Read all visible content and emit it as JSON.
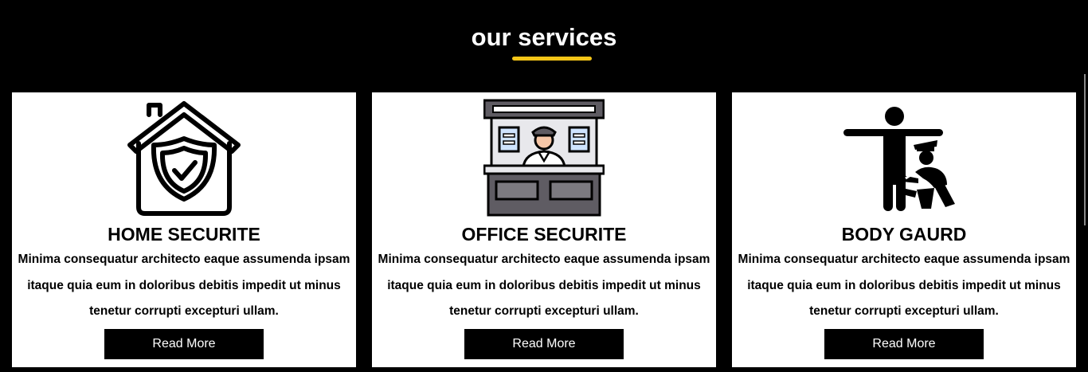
{
  "section": {
    "title": "our services",
    "accent_color": "#f5c518"
  },
  "cards": [
    {
      "icon": "home-shield-icon",
      "title": "HOME SECURITE",
      "text": "Minima consequatur architecto eaque assumenda ipsam itaque quia eum in doloribus debitis impedit ut minus tenetur corrupti excepturi ullam.",
      "button_label": "Read More"
    },
    {
      "icon": "security-guard-booth-icon",
      "title": "OFFICE SECURITE",
      "text": "Minima consequatur architecto eaque assumenda ipsam itaque quia eum in doloribus debitis impedit ut minus tenetur corrupti excepturi ullam.",
      "button_label": "Read More"
    },
    {
      "icon": "body-search-icon",
      "title": "BODY GAURD",
      "text": "Minima consequatur architecto eaque assumenda ipsam itaque quia eum in doloribus debitis impedit ut minus tenetur corrupti excepturi ullam.",
      "button_label": "Read More"
    }
  ]
}
